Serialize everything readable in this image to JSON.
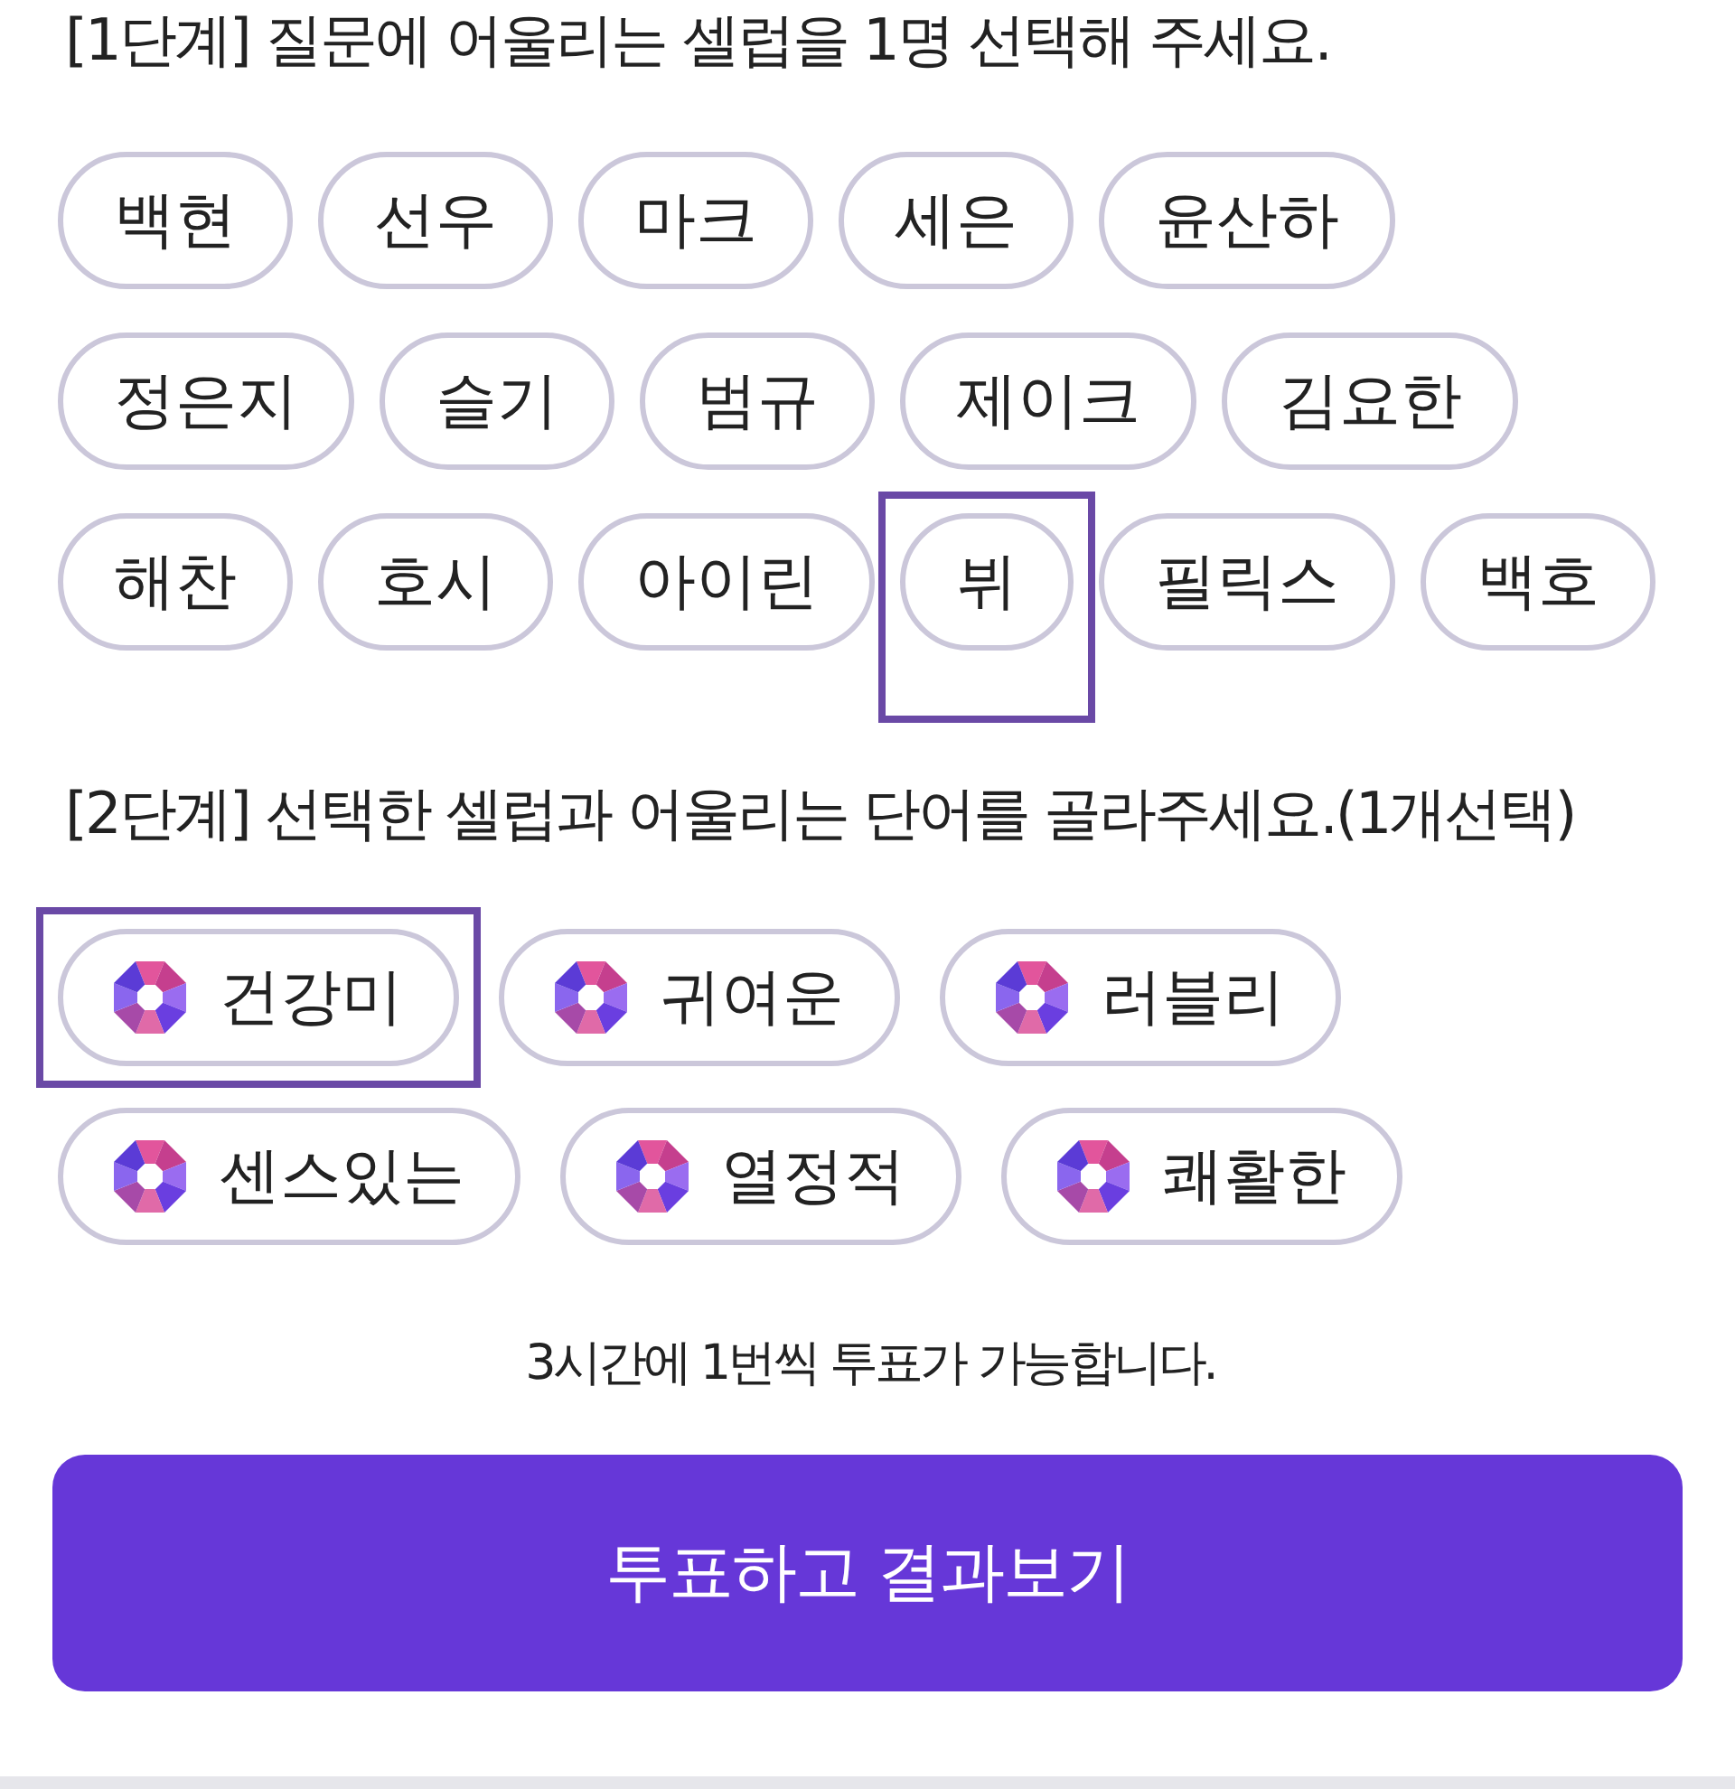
{
  "step1": {
    "heading": "[1단계] 질문에 어울리는 셀럽을 1명 선택해 주세요.",
    "options": [
      {
        "label": "백현",
        "selected": false
      },
      {
        "label": "선우",
        "selected": false
      },
      {
        "label": "마크",
        "selected": false
      },
      {
        "label": "세은",
        "selected": false
      },
      {
        "label": "윤산하",
        "selected": false
      },
      {
        "label": "정은지",
        "selected": false
      },
      {
        "label": "슬기",
        "selected": false
      },
      {
        "label": "범규",
        "selected": false
      },
      {
        "label": "제이크",
        "selected": false
      },
      {
        "label": "김요한",
        "selected": false
      },
      {
        "label": "해찬",
        "selected": false
      },
      {
        "label": "호시",
        "selected": false
      },
      {
        "label": "아이린",
        "selected": false
      },
      {
        "label": "뷔",
        "selected": true
      },
      {
        "label": "필릭스",
        "selected": false
      },
      {
        "label": "백호",
        "selected": false
      }
    ]
  },
  "step2": {
    "heading": "[2단계] 선택한 셀럽과 어울리는 단어를 골라주세요.(1개선택)",
    "options": [
      {
        "label": "건강미",
        "selected": true
      },
      {
        "label": "귀여운",
        "selected": false
      },
      {
        "label": "러블리",
        "selected": false
      },
      {
        "label": "센스있는",
        "selected": false
      },
      {
        "label": "열정적",
        "selected": false
      },
      {
        "label": "쾌활한",
        "selected": false
      }
    ]
  },
  "notice": "3시간에 1번씩 투표가 가능합니다.",
  "vote_button": "투표하고 결과보기"
}
